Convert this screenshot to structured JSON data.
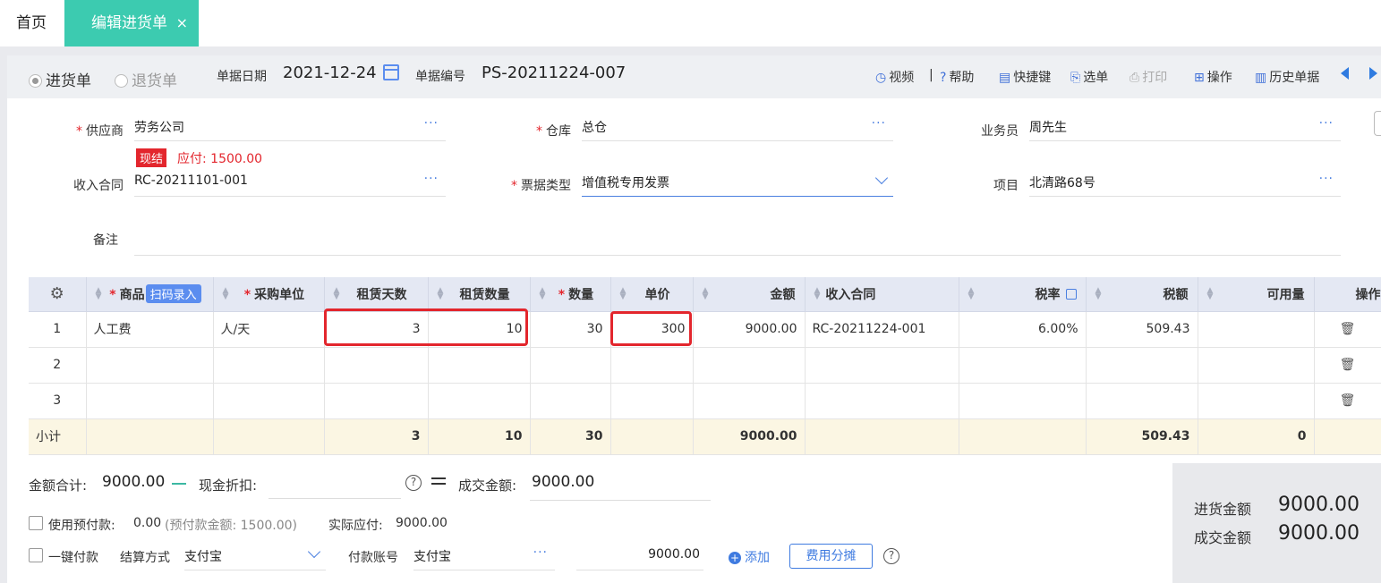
{
  "tabs": {
    "home": "首页",
    "active": "编辑进货单",
    "close": "×"
  },
  "header": {
    "radio_purchase": "进货单",
    "radio_return": "退货单",
    "date_label": "单据日期",
    "date_value": "2021-12-24",
    "number_label": "单据编号",
    "number_value": "PS-20211224-007",
    "tools": [
      {
        "icon": "play-circle-icon",
        "label": "视频"
      },
      {
        "icon": "help-circle-icon",
        "label": "帮助"
      },
      {
        "icon": "keyboard-icon",
        "label": "快捷键"
      },
      {
        "icon": "select-doc-icon",
        "label": "选单"
      },
      {
        "icon": "printer-icon",
        "label": "打印"
      },
      {
        "icon": "grid-icon",
        "label": "操作"
      },
      {
        "icon": "history-doc-icon",
        "label": "历史单据"
      }
    ],
    "separator": "|"
  },
  "form": {
    "supplier_label": "供应商",
    "supplier_value": "劳务公司",
    "cash_tag": "现结",
    "payable": "应付: 1500.00",
    "warehouse_label": "仓库",
    "warehouse_value": "总仓",
    "salesman_label": "业务员",
    "salesman_value": "周先生",
    "contract_label": "收入合同",
    "contract_value": "RC-20211101-001",
    "invoice_label": "票据类型",
    "invoice_value": "增值税专用发票",
    "project_label": "项目",
    "project_value": "北清路68号",
    "note_label": "备注",
    "ellipsis": "···"
  },
  "table": {
    "headers": {
      "product": "商品",
      "scan": "扫码录入",
      "unit": "采购单位",
      "rent_days": "租赁天数",
      "rent_qty": "租赁数量",
      "qty": "数量",
      "price": "单价",
      "amount": "金额",
      "contract": "收入合同",
      "tax_rate": "税率",
      "tax": "税额",
      "available": "可用量",
      "ops": "操作"
    },
    "rows": [
      {
        "no": "1",
        "product": "人工费",
        "unit": "人/天",
        "rent_days": "3",
        "rent_qty": "10",
        "qty": "30",
        "price": "300",
        "amount": "9000.00",
        "contract": "RC-20211224-001",
        "tax_rate": "6.00%",
        "tax": "509.43",
        "available": ""
      },
      {
        "no": "2",
        "product": "",
        "unit": "",
        "rent_days": "",
        "rent_qty": "",
        "qty": "",
        "price": "",
        "amount": "",
        "contract": "",
        "tax_rate": "",
        "tax": "",
        "available": ""
      },
      {
        "no": "3",
        "product": "",
        "unit": "",
        "rent_days": "",
        "rent_qty": "",
        "qty": "",
        "price": "",
        "amount": "",
        "contract": "",
        "tax_rate": "",
        "tax": "",
        "available": ""
      }
    ],
    "subtotal": {
      "label": "小计",
      "rent_days": "3",
      "rent_qty": "10",
      "qty": "30",
      "amount": "9000.00",
      "tax": "509.43",
      "available": "0"
    }
  },
  "bottom": {
    "total_label": "金额合计:",
    "total_value": "9000.00",
    "discount_label": "现金折扣:",
    "deal_label": "成交金额:",
    "deal_value": "9000.00",
    "use_prepay_label": "使用预付款:",
    "use_prepay_value": "0.00",
    "prepay_note": "(预付款金额: 1500.00)",
    "actual_label": "实际应付:",
    "actual_value": "9000.00",
    "one_click_label": "一键付款",
    "settle_label": "结算方式",
    "settle_value": "支付宝",
    "account_label": "付款账号",
    "account_value": "支付宝",
    "pay_amount": "9000.00",
    "add_label": "添加",
    "fee_split_label": "费用分摊",
    "help": "?"
  },
  "summary": {
    "purchase_label": "进货金额",
    "purchase_value": "9000.00",
    "deal_label": "成交金额",
    "deal_value": "9000.00"
  },
  "colors": {
    "accent": "#3ccbb0",
    "link": "#3f7be0",
    "required": "#e3262d",
    "subtotal_bg": "#fbf6e3"
  }
}
